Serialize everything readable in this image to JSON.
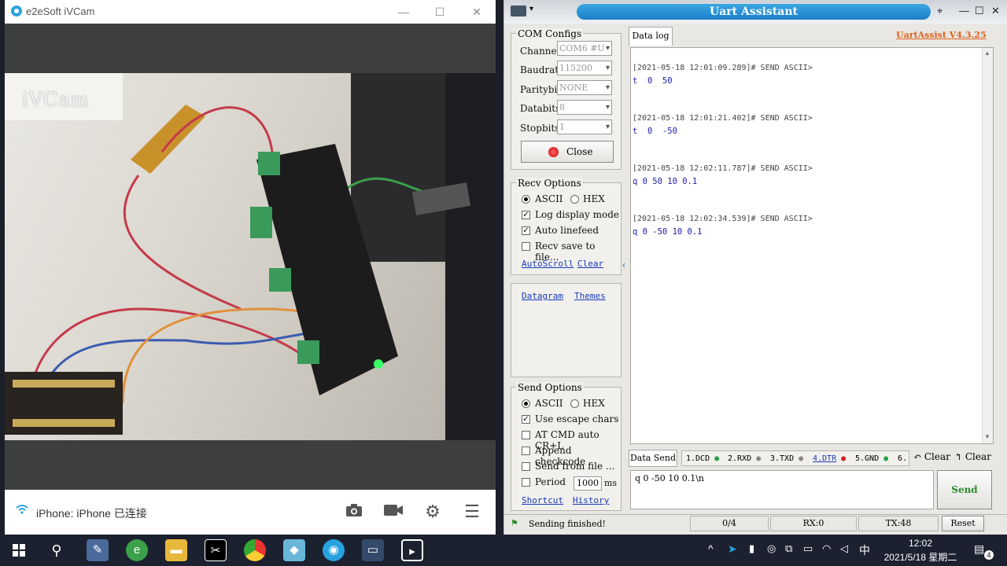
{
  "ivcam": {
    "title": "e2eSoft iVCam",
    "watermark": "iVCam",
    "status": "iPhone: iPhone 已连接",
    "icons": [
      "wifi-icon",
      "camera-icon",
      "video-icon",
      "gear-icon",
      "menu-icon"
    ]
  },
  "uart": {
    "title": "Uart Assistant",
    "version": "UartAssist V4.3.25",
    "com": {
      "group": "COM Configs",
      "channel_label": "Channel",
      "channel_value": "COM6 #U",
      "baud_label": "Baudrate",
      "baud_value": "115200",
      "parity_label": "Paritybits",
      "parity_value": "NONE",
      "data_label": "Databits",
      "data_value": "8",
      "stop_label": "Stopbits",
      "stop_value": "1",
      "close_button": "Close"
    },
    "recv": {
      "group": "Recv Options",
      "ascii": "ASCII",
      "hex": "HEX",
      "log_display": "Log display mode",
      "auto_linefeed": "Auto linefeed",
      "save_file": "Recv save to file...",
      "autoscroll": "AutoScroll",
      "clear": "Clear"
    },
    "links": {
      "datagram": "Datagram",
      "themes": "Themes"
    },
    "send": {
      "group": "Send Options",
      "ascii": "ASCII",
      "hex": "HEX",
      "escape": "Use escape chars",
      "at_cmd": "AT CMD auto CR+L",
      "checkcode": "Append checkcode",
      "from_file": "Send from file ...",
      "period": "Period",
      "period_value": "1000",
      "period_unit": "ms",
      "shortcut": "Shortcut",
      "history": "History"
    },
    "tab_datalog": "Data log",
    "log": [
      {
        "head": "[2021-05-18 12:01:09.289]# SEND ASCII>",
        "data": "t  0  50"
      },
      {
        "head": "[2021-05-18 12:01:21.402]# SEND ASCII>",
        "data": "t  0  -50"
      },
      {
        "head": "[2021-05-18 12:02:11.787]# SEND ASCII>",
        "data": "q 0 50 10 0.1"
      },
      {
        "head": "[2021-05-18 12:02:34.539]# SEND ASCII>",
        "data": "q 0 -50 10 0.1"
      }
    ],
    "datasend": {
      "tab": "Data Send",
      "pins": [
        "1.DCD",
        "2.RXD",
        "3.TXD",
        "4.DTR",
        "5.GND",
        "6."
      ],
      "pin_colors": [
        "#2aa04a",
        "#888888",
        "#888888",
        "#d02020",
        "#2aa04a"
      ],
      "clear1": "Clear",
      "clear2": "Clear",
      "input": "q 0 -50 10 0.1\\n",
      "send_button": "Send"
    },
    "status": {
      "message": "Sending finished!",
      "count": "0/4",
      "rx": "RX:0",
      "tx": "TX:48",
      "reset": "Reset"
    }
  },
  "taskbar": {
    "clock_time": "12:02",
    "clock_date": "2021/5/18 星期二",
    "ime": "中",
    "notifications": "4"
  }
}
